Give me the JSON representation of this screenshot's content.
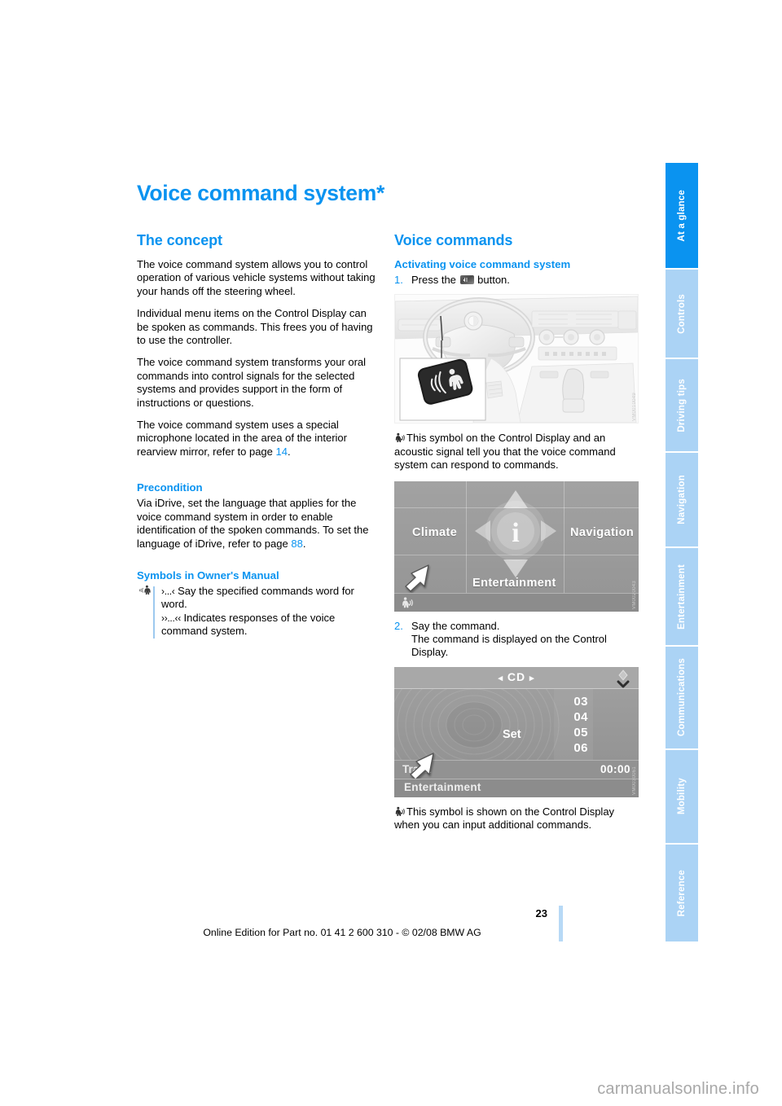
{
  "document": {
    "title": "Voice command system*"
  },
  "sidebar": {
    "tabs": [
      {
        "label": "At a glance",
        "active": true
      },
      {
        "label": "Controls",
        "active": false
      },
      {
        "label": "Driving tips",
        "active": false
      },
      {
        "label": "Navigation",
        "active": false
      },
      {
        "label": "Entertainment",
        "active": false
      },
      {
        "label": "Communications",
        "active": false
      },
      {
        "label": "Mobility",
        "active": false
      },
      {
        "label": "Reference",
        "active": false
      }
    ]
  },
  "left_column": {
    "section_concept": {
      "heading": "The concept",
      "paragraph_1": "The voice command system allows you to control operation of various vehicle systems without taking your hands off the steering wheel.",
      "paragraph_2": "Individual menu items on the Control Display can be spoken as commands. This frees you of having to use the controller.",
      "paragraph_3": "The voice command system transforms your oral commands into control signals for the selected systems and provides support in the form of instructions or questions.",
      "paragraph_4_pre": "The voice command system uses a special microphone located in the area of the interior rearview mirror, refer to page ",
      "paragraph_4_ref": "14",
      "paragraph_4_post": "."
    },
    "section_precondition": {
      "heading": "Precondition",
      "paragraph_pre": "Via iDrive, set the language that applies for the voice command system in order to enable identification of the spoken commands. To set the language of iDrive, refer to page ",
      "paragraph_ref": "88",
      "paragraph_post": "."
    },
    "section_symbols": {
      "heading": "Symbols in Owner's Manual",
      "icon_name": "voice-command-manual-symbol",
      "note_line_1_quote": "›...‹",
      "note_line_1_text": " Say the specified commands word for word.",
      "note_line_2_quote": "››...‹‹",
      "note_line_2_text": " Indicates responses of the voice command system."
    }
  },
  "right_column": {
    "section_voice_commands": {
      "heading": "Voice commands",
      "subheading": "Activating voice command system",
      "step_1": {
        "number": "1.",
        "text_before": "Press the ",
        "button_icon": "voice-command-button-icon",
        "text_after": " button."
      },
      "figure_1": {
        "name": "car-interior-voice-button-illustration",
        "code": "VM0010049"
      },
      "caption_1": {
        "symbol": "voice-active-symbol",
        "text": "This symbol on the Control Display and an acoustic signal tell you that the voice command system can respond to commands."
      },
      "figure_2": {
        "name": "idrive-main-menu-screenshot",
        "code": "VM0020043",
        "screen": {
          "menu_left": "Climate",
          "menu_right": "Navigation",
          "menu_bottom": "Entertainment",
          "center_icon": "info-i-icon",
          "status_symbol": "voice-active-symbol",
          "cursor": "white-arrow-cursor"
        }
      },
      "step_2": {
        "number": "2.",
        "line_1": "Say the command.",
        "line_2": "The command is displayed on the Control Display."
      },
      "figure_3": {
        "name": "idrive-cd-screen-screenshot",
        "code": "VM0030061",
        "screen": {
          "title": "CD",
          "nav_prev": "◂",
          "nav_next": "▸",
          "track_numbers": [
            "03",
            "04",
            "05",
            "06"
          ],
          "set_label": "Set",
          "track_label": "Track",
          "time": "00:00",
          "status_label": "Entertainment",
          "cursor": "white-arrow-cursor",
          "corner_icon": "chevron-down-icon"
        }
      },
      "caption_2": {
        "symbol": "voice-active-symbol",
        "text": "This symbol is shown on the Control Display when you can input additional commands."
      }
    }
  },
  "footer": {
    "page_number": "23",
    "edition_line": "Online Edition for Part no. 01 41 2 600 310 - © 02/08 BMW AG"
  },
  "watermark": {
    "text": "carmanualsonline.info"
  },
  "colors": {
    "accent_blue": "#0a93f0",
    "tab_inactive": "#abd3f5",
    "rule_blue": "#9dc9ef"
  }
}
